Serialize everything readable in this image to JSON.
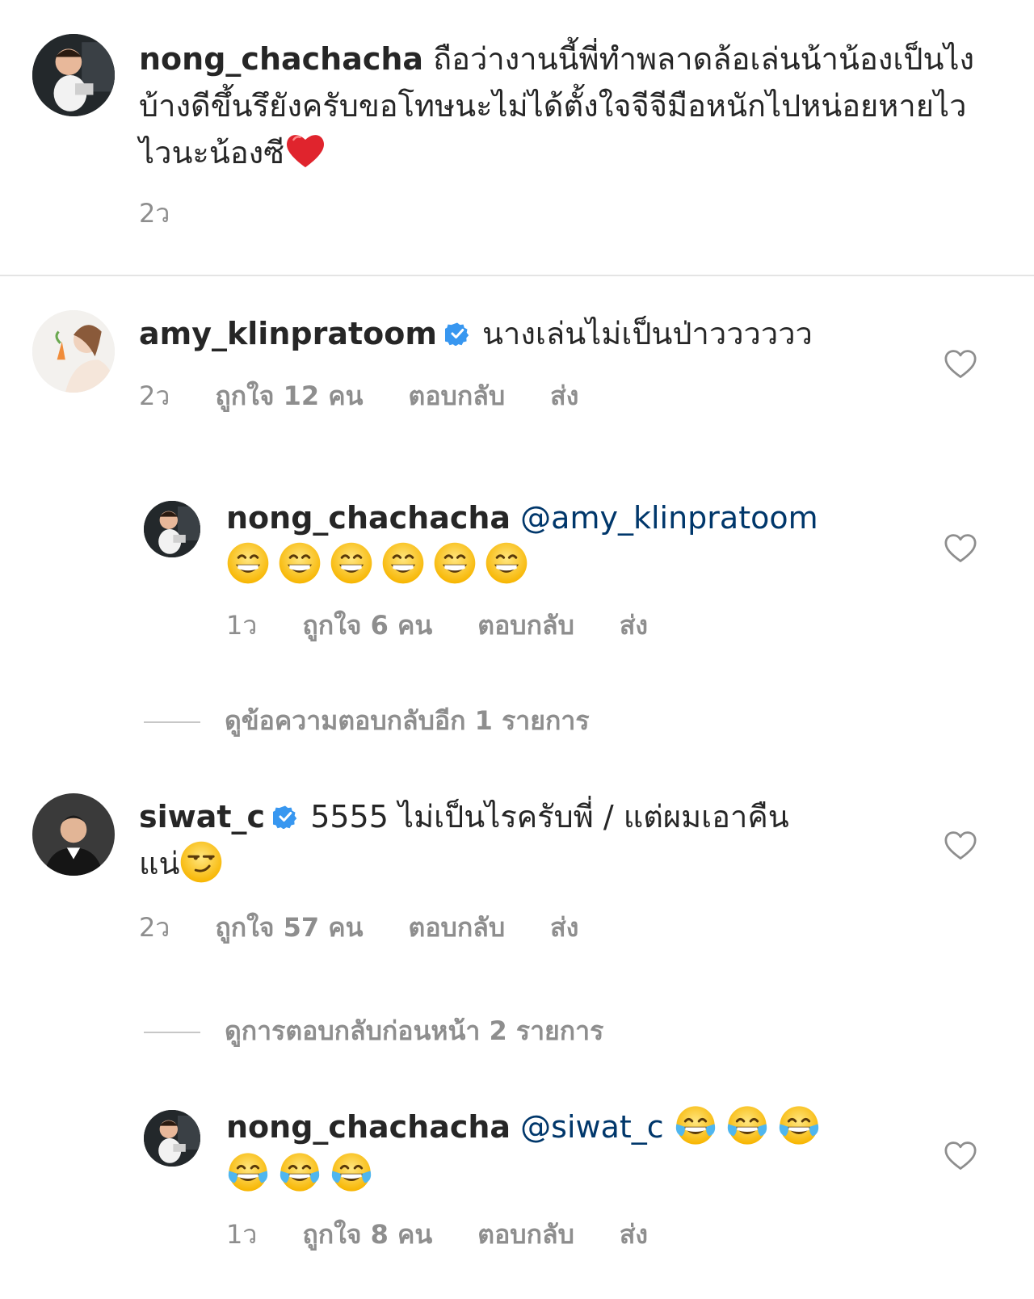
{
  "colors": {
    "text": "#262626",
    "meta": "#8e8e8e",
    "mention": "#00376b",
    "verified": "#3897f0",
    "heart_emoji": "#e0242d",
    "divider": "#e4e4e4"
  },
  "caption": {
    "username": "nong_chachacha",
    "text": "ถือว่างานนี้พี่ทำพลาดล้อเล่นน้าน้องเป็นไงบ้างดีขึ้นรึยังครับขอโทษนะไม่ได้ตั้งใจจีจีมือหนักไปหน่อยหายไวไวนะน้องซี",
    "emoji": "heart-emoji",
    "time": "2ว"
  },
  "comments": [
    {
      "username": "amy_klinpratoom",
      "verified": true,
      "text": "นางเล่นไม่เป็นป่าวววววว",
      "time": "2ว",
      "likes": "ถูกใจ 12 คน",
      "reply": "ตอบกลับ",
      "send": "ส่ง"
    },
    {
      "username": "nong_chachacha",
      "mention": "@amy_klinpratoom",
      "emojis": [
        "grin-emoji",
        "grin-emoji",
        "grin-emoji",
        "grin-emoji",
        "grin-emoji",
        "grin-emoji"
      ],
      "time": "1ว",
      "likes": "ถูกใจ 6 คน",
      "reply": "ตอบกลับ",
      "send": "ส่ง"
    },
    {
      "view_replies": "ดูข้อความตอบกลับอีก 1 รายการ"
    },
    {
      "username": "siwat_c",
      "verified": true,
      "text_line1": "5555 ไม่เป็นไรครับพี่ / แต่ผมเอาคืน",
      "text_line2": "แน่",
      "emoji": "smirk-emoji",
      "time": "2ว",
      "likes": "ถูกใจ 57 คน",
      "reply": "ตอบกลับ",
      "send": "ส่ง"
    },
    {
      "view_replies": "ดูการตอบกลับก่อนหน้า 2 รายการ"
    },
    {
      "username": "nong_chachacha",
      "mention": "@siwat_c",
      "emojis": [
        "joy-emoji",
        "joy-emoji",
        "joy-emoji",
        "joy-emoji",
        "joy-emoji",
        "joy-emoji"
      ],
      "time": "1ว",
      "likes": "ถูกใจ 8 คน",
      "reply": "ตอบกลับ",
      "send": "ส่ง"
    }
  ]
}
